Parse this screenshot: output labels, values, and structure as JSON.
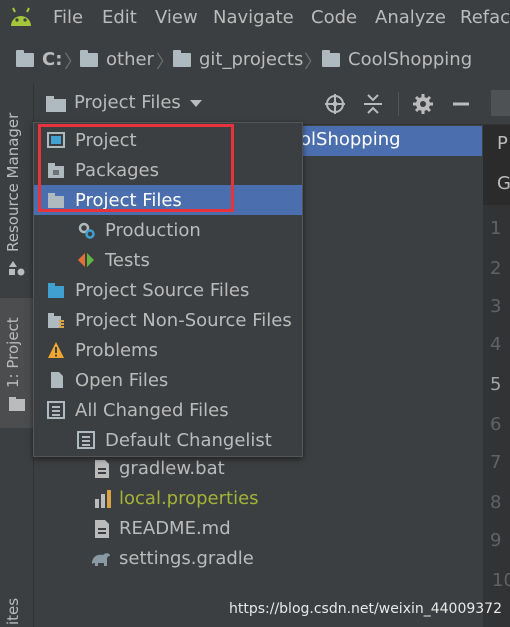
{
  "menu": [
    "File",
    "Edit",
    "View",
    "Navigate",
    "Code",
    "Analyze",
    "Refact"
  ],
  "breadcrumb": [
    "C:",
    "other",
    "git_projects",
    "CoolShopping"
  ],
  "left_tabs": {
    "resource_manager": "Resource Manager",
    "project": "1: Project",
    "bottom": "ites"
  },
  "tool_window": {
    "title": "Project Files"
  },
  "tree": {
    "selected_partial": "olShopping",
    "files": [
      {
        "name": "gradlew.bat",
        "color": "#bbbbbb",
        "icon": "file-icon"
      },
      {
        "name": "local.properties",
        "color": "#a4b337",
        "icon": "properties-icon"
      },
      {
        "name": "README.md",
        "color": "#bbbbbb",
        "icon": "file-icon"
      },
      {
        "name": "settings.gradle",
        "color": "#bbbbbb",
        "icon": "gradle-icon"
      }
    ]
  },
  "popup": {
    "items": [
      {
        "label": "Project",
        "icon": "project-view-icon",
        "indent": 0,
        "selected": false
      },
      {
        "label": "Packages",
        "icon": "packages-icon",
        "indent": 0,
        "selected": false
      },
      {
        "label": "Project Files",
        "icon": "folder-icon",
        "indent": 0,
        "selected": true
      },
      {
        "label": "Production",
        "icon": "production-scope-icon",
        "indent": 1,
        "selected": false
      },
      {
        "label": "Tests",
        "icon": "tests-scope-icon",
        "indent": 1,
        "selected": false
      },
      {
        "label": "Project Source Files",
        "icon": "source-folder-icon",
        "indent": 0,
        "selected": false
      },
      {
        "label": "Project Non-Source Files",
        "icon": "non-source-icon",
        "indent": 0,
        "selected": false
      },
      {
        "label": "Problems",
        "icon": "warning-icon",
        "indent": 0,
        "selected": false
      },
      {
        "label": "Open Files",
        "icon": "open-files-icon",
        "indent": 0,
        "selected": false
      },
      {
        "label": "All Changed Files",
        "icon": "changes-icon",
        "indent": 0,
        "selected": false
      },
      {
        "label": "Default Changelist",
        "icon": "changelist-icon",
        "indent": 1,
        "selected": false
      }
    ]
  },
  "editor": {
    "tab_letters": [
      "P",
      "G"
    ],
    "line_numbers": [
      "1",
      "2",
      "3",
      "4",
      "5",
      "6",
      "7",
      "8",
      "9",
      "10"
    ]
  },
  "watermark": "https://blog.csdn.net/weixin_44009372",
  "colors": {
    "selection": "#4b6eaf",
    "highlight_box": "#e8323c",
    "panel": "#3c3f41"
  }
}
